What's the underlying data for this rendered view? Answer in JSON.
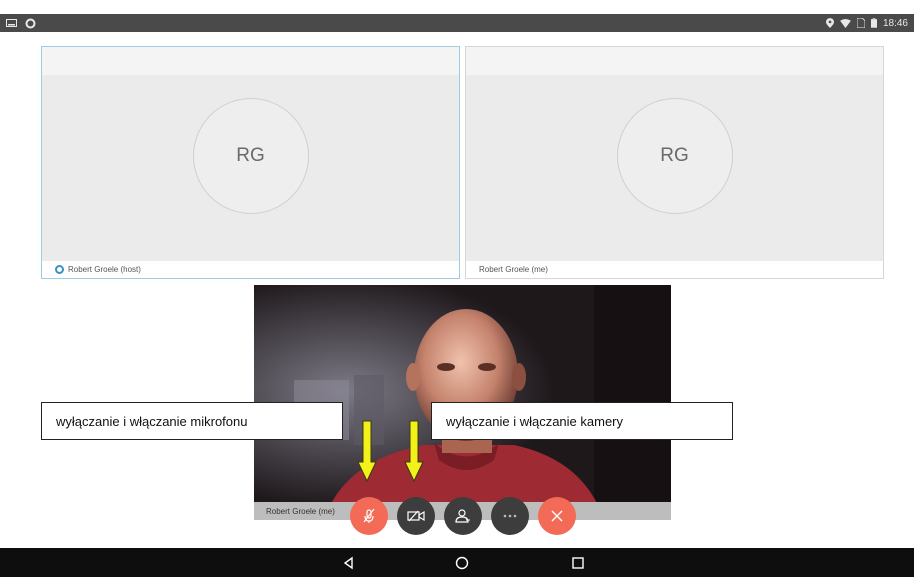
{
  "status_bar": {
    "time": "18:46",
    "left_icons": [
      "screenshot-icon",
      "sync-icon"
    ],
    "right_icons": [
      "location-icon",
      "wifi-icon",
      "sim-icon",
      "battery-icon"
    ]
  },
  "participants": [
    {
      "initials": "RG",
      "name": "Robert Groele (host)",
      "is_host": true
    },
    {
      "initials": "RG",
      "name": "Robert Groele (me)",
      "is_host": false
    }
  ],
  "self_view": {
    "name": "Robert Groele (me)"
  },
  "annotations": {
    "microphone": "wyłączanie i włączanie mikrofonu",
    "camera": "wyłączanie i włączanie kamery"
  },
  "controls": [
    {
      "name": "mute-microphone",
      "icon": "microphone-off-icon",
      "color": "#f36a56"
    },
    {
      "name": "toggle-camera",
      "icon": "camera-off-icon",
      "color": "#3d3d3d"
    },
    {
      "name": "participants",
      "icon": "participants-icon",
      "color": "#3d3d3d"
    },
    {
      "name": "more-options",
      "icon": "more-icon",
      "color": "#3d3d3d"
    },
    {
      "name": "end-call",
      "icon": "close-icon",
      "color": "#f36a56"
    }
  ],
  "arrow_color": "#f2f21a",
  "nav": [
    "back-icon",
    "home-icon",
    "recents-icon"
  ]
}
